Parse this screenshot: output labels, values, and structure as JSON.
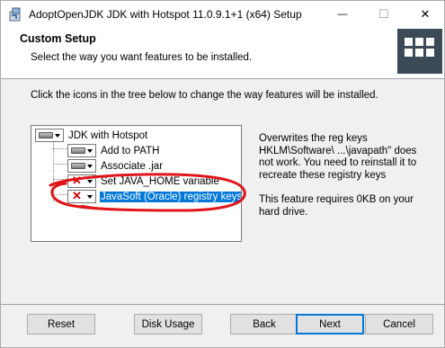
{
  "window": {
    "title": "AdoptOpenJDK JDK with Hotspot 11.0.9.1+1 (x64) Setup",
    "minimize_glyph": "—",
    "maximize_glyph": "☐",
    "close_glyph": "✕"
  },
  "header": {
    "title": "Custom Setup",
    "subtitle": "Select the way you want features to be installed."
  },
  "instruction": "Click the icons in the tree below to change the way features will be installed.",
  "tree": {
    "items": [
      {
        "label": "JDK with Hotspot",
        "state": "install",
        "icon": "drive-icon"
      },
      {
        "label": "Add to PATH",
        "state": "install",
        "icon": "drive-icon"
      },
      {
        "label": "Associate .jar",
        "state": "install",
        "icon": "drive-icon"
      },
      {
        "label": "Set JAVA_HOME variable",
        "state": "unavailable",
        "icon": "x-icon"
      },
      {
        "label": "JavaSoft (Oracle) registry keys",
        "state": "unavailable",
        "icon": "x-icon",
        "selected": true
      }
    ]
  },
  "description": {
    "text": "Overwrites the reg keys HKLM\\Software\\ ...\\javapath\" does not work. You need to reinstall it to recreate these registry keys",
    "size_note": "This feature requires 0KB on your hard drive."
  },
  "footer": {
    "reset": "Reset",
    "disk_usage": "Disk Usage",
    "back": "Back",
    "next": "Next",
    "cancel": "Cancel"
  },
  "colors": {
    "accent": "#0078d7",
    "annotation": "#e0141a",
    "logo_bg": "#3b4a56"
  }
}
